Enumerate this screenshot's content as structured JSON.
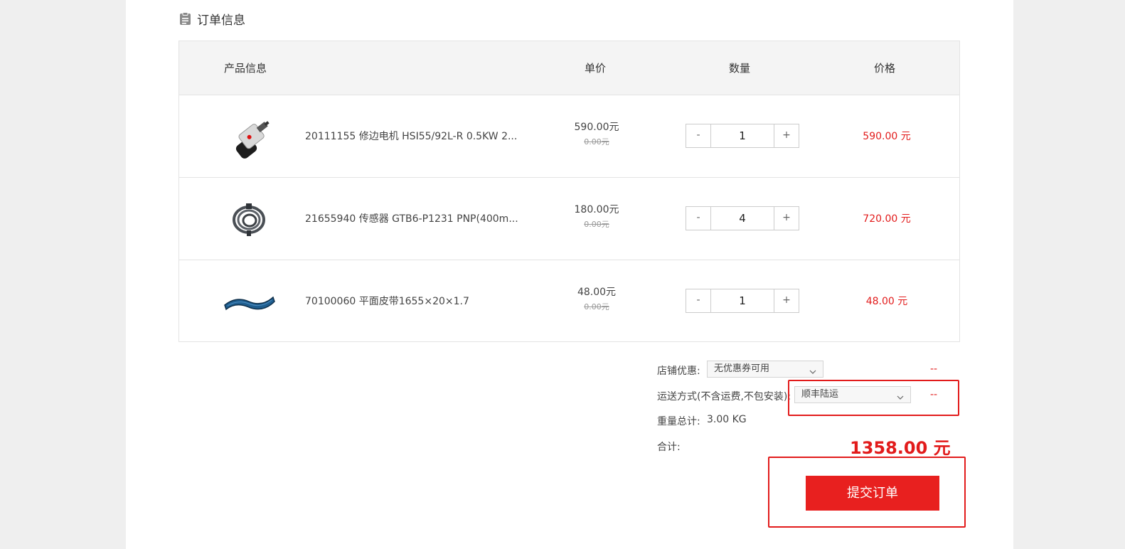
{
  "section": {
    "title": "订单信息",
    "icon": "clipboard-icon"
  },
  "table": {
    "headers": {
      "product": "产品信息",
      "unit_price": "单价",
      "quantity": "数量",
      "price": "价格"
    },
    "rows": [
      {
        "image": "motor-product-image",
        "name": "20111155 修边电机 HSI55/92L-R 0.5KW 2...",
        "unit_price": "590.00元",
        "original_price": "0.00元",
        "minus": "-",
        "quantity": "1",
        "plus": "+",
        "subtotal": "590.00 元"
      },
      {
        "image": "sensor-product-image",
        "name": "21655940 传感器 GTB6-P1231 PNP(400m...",
        "unit_price": "180.00元",
        "original_price": "0.00元",
        "minus": "-",
        "quantity": "4",
        "plus": "+",
        "subtotal": "720.00 元"
      },
      {
        "image": "belt-product-image",
        "name": "70100060 平面皮带1655×20×1.7",
        "unit_price": "48.00元",
        "original_price": "0.00元",
        "minus": "-",
        "quantity": "1",
        "plus": "+",
        "subtotal": "48.00 元"
      }
    ]
  },
  "summary": {
    "coupon_label": "店铺优惠:",
    "coupon_value": "无优惠券可用",
    "coupon_amount": "--",
    "shipping_label": "运送方式(不含运费,不包安装):",
    "shipping_value": "顺丰陆运",
    "shipping_amount": "--",
    "weight_label": "重量总计:",
    "weight_value": "3.00 KG",
    "total_label": "合计:",
    "total_value": "1358.00 元"
  },
  "submit_label": "提交订单",
  "colors": {
    "accent": "#e8201f",
    "price_red": "#e21b1b",
    "header_bg": "#f4f4f4"
  }
}
